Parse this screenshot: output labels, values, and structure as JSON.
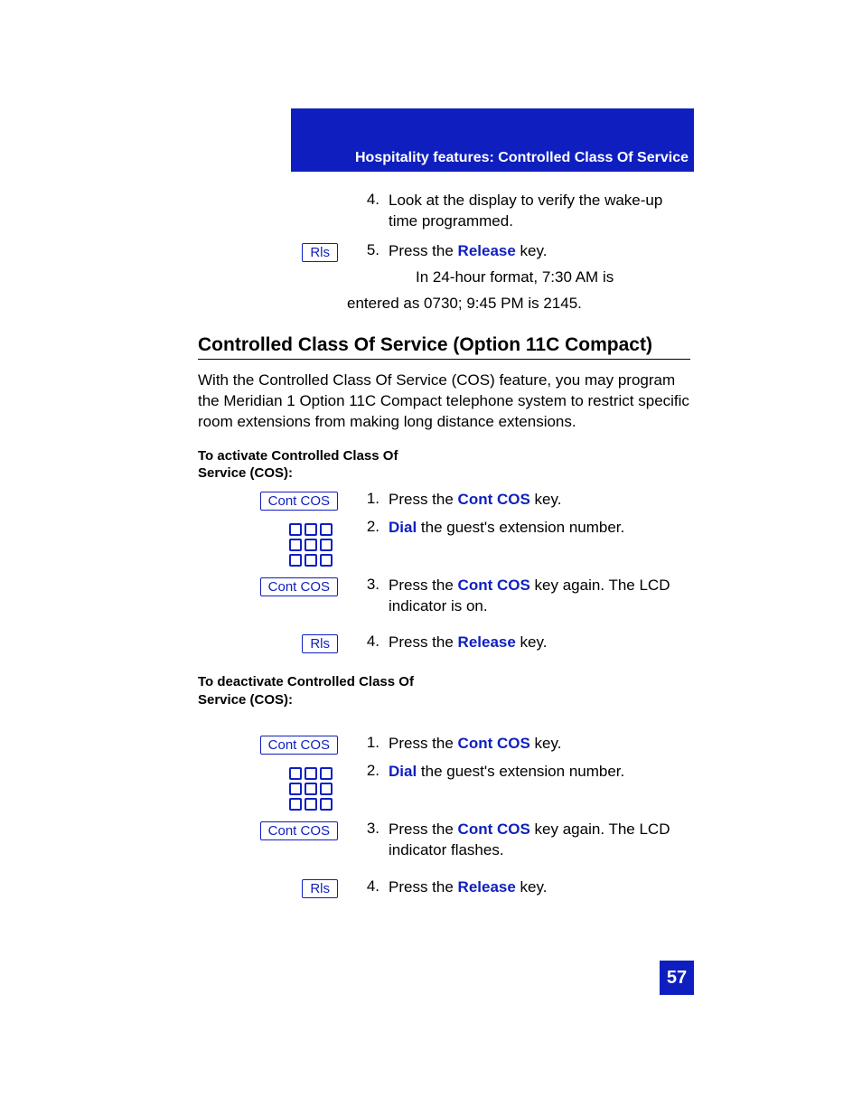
{
  "header": "Hospitality features: Controlled Class Of Service",
  "top_steps": [
    {
      "num": "4.",
      "button": null,
      "pre": "Look at the display to verify the wake-up time programmed.",
      "bold": null,
      "post": null
    },
    {
      "num": "5.",
      "button": "Rls",
      "pre": "Press the ",
      "bold": "Release",
      "post": " key."
    }
  ],
  "note_line1": "In 24-hour format, 7:30 AM is",
  "note_line2": "entered as 0730; 9:45 PM is 2145.",
  "section_title": "Controlled Class Of Service (Option 11C Compact)",
  "intro": "With the Controlled Class Of Service (COS) feature, you may program the Meridian 1 Option 11C Compact telephone system to restrict specific room extensions from making long distance extensions.",
  "activate_head": "To activate Controlled Class Of Service (COS):",
  "activate_steps": [
    {
      "num": "1.",
      "button": "Cont COS",
      "pre": "Press the ",
      "bold": "Cont COS",
      "post": " key.",
      "keypad": false
    },
    {
      "num": "2.",
      "button": null,
      "pre": "",
      "bold": "Dial",
      "post": " the guest's extension number.",
      "keypad": true
    },
    {
      "num": "3.",
      "button": "Cont COS",
      "pre": "Press the ",
      "bold": "Cont COS",
      "post": " key again. The LCD indicator is on.",
      "keypad": false
    },
    {
      "num": "4.",
      "button": "Rls",
      "pre": "Press the ",
      "bold": "Release",
      "post": " key.",
      "keypad": false
    }
  ],
  "deactivate_head": "To deactivate Controlled Class Of Service (COS):",
  "deactivate_steps": [
    {
      "num": "1.",
      "button": "Cont COS",
      "pre": "Press the ",
      "bold": "Cont COS",
      "post": " key.",
      "keypad": false
    },
    {
      "num": "2.",
      "button": null,
      "pre": "",
      "bold": "Dial",
      "post": " the guest's extension number.",
      "keypad": true
    },
    {
      "num": "3.",
      "button": "Cont COS",
      "pre": "Press the ",
      "bold": "Cont COS",
      "post": " key again. The LCD indicator flashes.",
      "keypad": false
    },
    {
      "num": "4.",
      "button": "Rls",
      "pre": "Press the ",
      "bold": "Release",
      "post": " key.",
      "keypad": false
    }
  ],
  "page_number": "57"
}
